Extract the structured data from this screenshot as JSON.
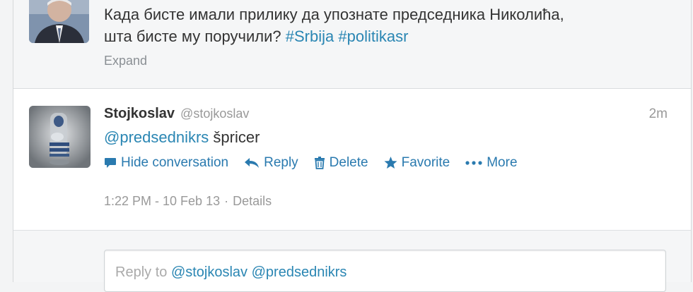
{
  "previous_tweet": {
    "text_line1": "Када бисте имали прилику да упознате председника Николића,",
    "text_line2_prefix": "шта бисте му поручили?",
    "hashtags": [
      "#Srbija",
      "#politikasr"
    ],
    "expand_label": "Expand"
  },
  "tweet": {
    "full_name": "Stojkoslav",
    "username": "@stojkoslav",
    "time": "2m",
    "mention": "@predsednikrs",
    "body": "špricer",
    "actions": {
      "hide_conversation": "Hide conversation",
      "reply": "Reply",
      "delete": "Delete",
      "favorite": "Favorite",
      "more": "More"
    },
    "timestamp": "1:22 PM - 10 Feb 13",
    "separator": "·",
    "details": "Details"
  },
  "reply_box": {
    "prefix": "Reply to",
    "mention1": "@stojkoslav",
    "mention2": "@predsednikrs"
  },
  "colors": {
    "link": "#2a86b3",
    "action": "#2a7aaf",
    "muted": "#999999"
  }
}
